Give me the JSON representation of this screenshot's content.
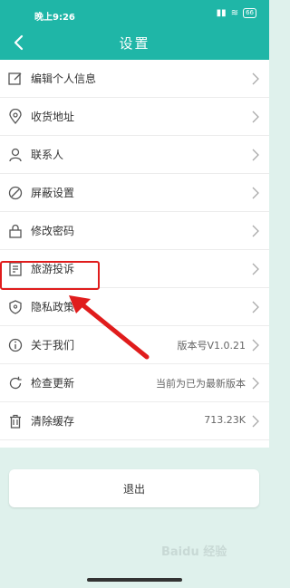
{
  "status_bar": {
    "time": "晚上9:26",
    "battery": "66"
  },
  "header": {
    "title": "设置"
  },
  "settings": {
    "items": [
      {
        "label": "编辑个人信息",
        "value": ""
      },
      {
        "label": "收货地址",
        "value": ""
      },
      {
        "label": "联系人",
        "value": ""
      },
      {
        "label": "屏蔽设置",
        "value": ""
      },
      {
        "label": "修改密码",
        "value": ""
      },
      {
        "label": "旅游投诉",
        "value": ""
      },
      {
        "label": "隐私政策",
        "value": ""
      },
      {
        "label": "关于我们",
        "value": "版本号V1.0.21"
      },
      {
        "label": "检查更新",
        "value": "当前为已为最新版本"
      },
      {
        "label": "清除缓存",
        "value": "713.23K"
      }
    ]
  },
  "logout_label": "退出",
  "watermark": "Baidu 经验",
  "colors": {
    "header": "#1fb6a7",
    "highlight": "#e01c1c",
    "background": "#dff1ec"
  }
}
